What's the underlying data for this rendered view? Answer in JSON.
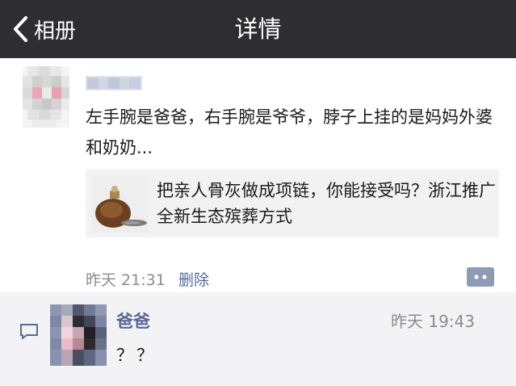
{
  "navbar": {
    "back_label": "相册",
    "title": "详情"
  },
  "post": {
    "text": "左手腕是爸爸，右手腕是爷爷，脖子上挂的是妈妈外婆和奶奶...",
    "link": {
      "title": "把亲人骨灰做成项链，你能接受吗？浙江推广全新生态殡葬方式"
    },
    "time": "昨天 21:31",
    "delete_label": "删除"
  },
  "comment": {
    "author": "爸爸",
    "time": "昨天 19:43",
    "text": "？？"
  },
  "colors": {
    "navbar_bg": "#2e2e32",
    "link_blue": "#566a95",
    "meta_gray": "#8c8c8c",
    "comment_bg": "#f3f3f5"
  },
  "icons": {
    "back": "chevron-left-icon",
    "comment_button": "comment-more-icon",
    "comment_marker": "comment-bubble-icon"
  }
}
